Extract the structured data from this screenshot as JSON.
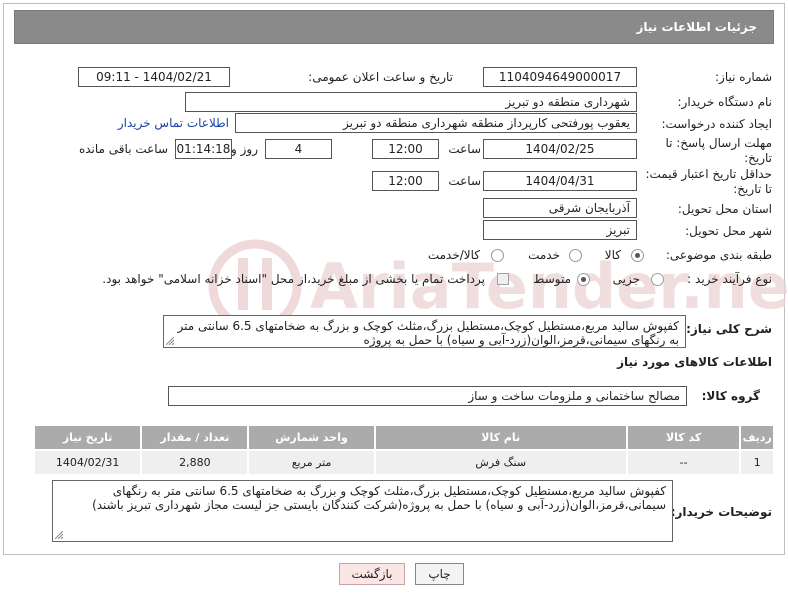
{
  "header": {
    "title": "جزئیات اطلاعات نیاز"
  },
  "fields": {
    "need_number_label": "شماره نیاز:",
    "need_number": "1104094649000017",
    "announce_label": "تاریخ و ساعت اعلان عمومی:",
    "announce_value": "1404/02/21 - 09:11",
    "buyer_label": "نام دستگاه خریدار:",
    "buyer_value": "شهرداری منطقه دو تبریز",
    "creator_label": "ایجاد کننده درخواست:",
    "creator_value": "یعقوب پورفتحی کارپرداز منطقه شهرداری منطقه دو تبریز",
    "contact_link": "اطلاعات تماس خریدار",
    "deadline_label_1": "مهلت ارسال پاسخ: تا",
    "deadline_label_2": "تاریخ:",
    "deadline_date": "1404/02/25",
    "time_label": "ساعت",
    "deadline_time": "12:00",
    "days_value": "4",
    "days_label": "روز و",
    "remaining_time": "01:14:18",
    "remaining_label": "ساعت باقی مانده",
    "validity_label_1": "حداقل تاریخ اعتبار قیمت:",
    "validity_label_2": "تا تاریخ:",
    "validity_date": "1404/04/31",
    "validity_time_label": "ساعت",
    "validity_time": "12:00",
    "province_label": "استان محل تحویل:",
    "province_value": "آذربایجان شرقی",
    "city_label": "شهر محل تحویل:",
    "city_value": "تبریز",
    "category_label": "طبقه بندی موضوعی:",
    "category_options": [
      "کالا",
      "خدمت",
      "کالا/خدمت"
    ],
    "category_selected": "کالا",
    "process_label": "نوع فرآیند خرید :",
    "process_options": [
      "جزیی",
      "متوسط"
    ],
    "process_selected": "متوسط",
    "payment_note": "پرداخت تمام یا بخشی از مبلغ خرید،از محل \"اسناد خزانه اسلامی\" خواهد بود."
  },
  "description": {
    "label": "شرح کلی نیاز:",
    "text": "کفپوش سالید مربع،مستطیل کوچک،مستطیل بزرگ،مثلث کوچک و بزرگ به ضخامتهای 6.5 سانتی متر به رنگهای سیمانی،قرمز،الوان(زرد-آبی و سیاه) با حمل به پروژه"
  },
  "goods_info": {
    "title": "اطلاعات کالاهای مورد نیاز",
    "group_label": "گروه کالا:",
    "group_value": "مصالح ساختمانی و ملزومات ساخت و ساز"
  },
  "table": {
    "headers": [
      "ردیف",
      "کد کالا",
      "نام کالا",
      "واحد شمارش",
      "تعداد / مقدار",
      "تاریخ نیاز"
    ],
    "rows": [
      [
        "1",
        "--",
        "سنگ فرش",
        "متر مربع",
        "2,880",
        "1404/02/31"
      ]
    ]
  },
  "buyer_notes": {
    "label": "توضیحات خریدار:",
    "text": "کفپوش سالید مربع،مستطیل کوچک،مستطیل بزرگ،مثلث کوچک و بزرگ به ضخامتهای 6.5 سانتی متر به رنگهای سیمانی،قرمز،الوان(زرد-آبی و سیاه) با حمل به پروژه(شرکت کنندگان بایستی جز لیست مجاز شهرداری تبریز باشند)"
  },
  "buttons": {
    "print": "چاپ",
    "back": "بازگشت"
  },
  "watermark": "AriaTender.neT",
  "colors": {
    "header_bg": "#8a8a8a",
    "table_header_bg": "#ababab",
    "link": "#1a44a8",
    "back_button_bg": "#fbe6e6"
  }
}
